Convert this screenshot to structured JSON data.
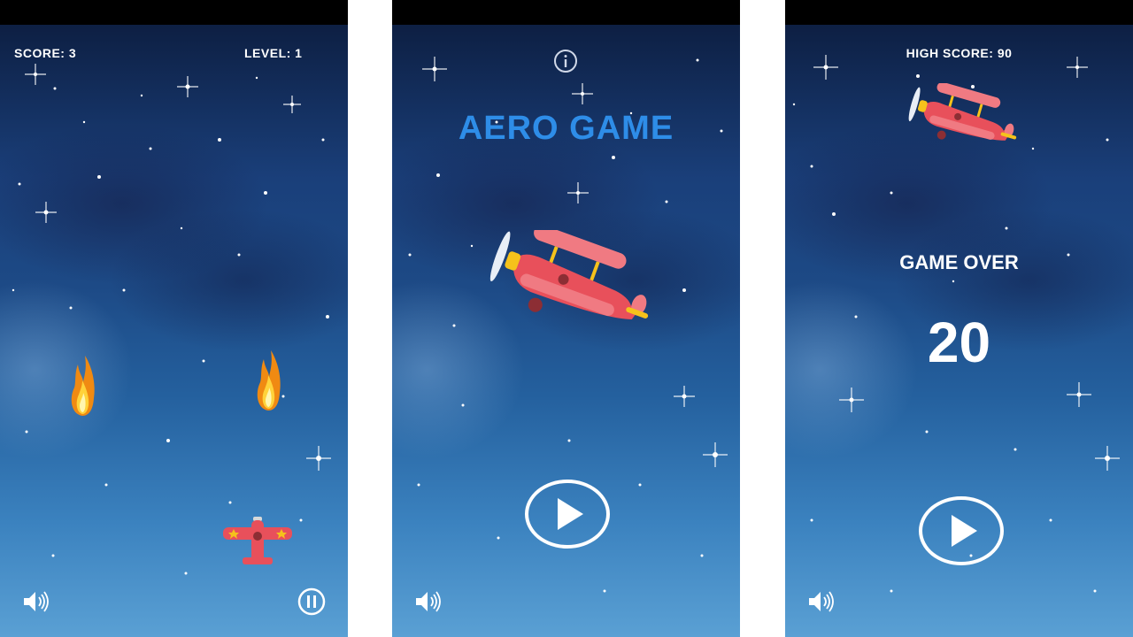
{
  "screens": {
    "gameplay": {
      "score_label": "SCORE: 3",
      "level_label": "LEVEL: 1",
      "icons": [
        "sound-icon",
        "pause-icon",
        "fireball-icon",
        "player-plane-icon"
      ]
    },
    "menu": {
      "title": "AERO GAME",
      "icons": [
        "info-icon",
        "biplane-icon",
        "play-icon",
        "sound-icon"
      ]
    },
    "game_over": {
      "high_score_label": "HIGH SCORE: 90",
      "game_over_label": "GAME OVER",
      "final_score": "20",
      "icons": [
        "biplane-icon",
        "play-icon",
        "sound-icon"
      ]
    }
  },
  "colors": {
    "title_blue": "#2e8de8",
    "plane_red": "#e8505b",
    "wing_yellow": "#f5c21b",
    "hud_white": "#ffffff",
    "status_bar": "#000000"
  }
}
